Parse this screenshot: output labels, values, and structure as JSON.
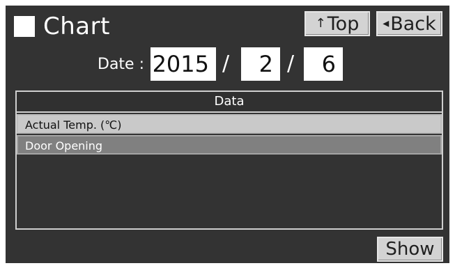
{
  "header": {
    "title": "Chart",
    "top_icon": "↑",
    "top_label": "Top",
    "back_icon": "◂",
    "back_label": "Back"
  },
  "date": {
    "label": "Date :",
    "year": "2015",
    "month": "2",
    "day": "6",
    "separator": "/"
  },
  "data_list": {
    "header": "Data",
    "items": [
      {
        "label": "Actual Temp. (℃)",
        "selected": true
      },
      {
        "label": "Door Opening",
        "selected": false
      }
    ]
  },
  "footer": {
    "show_label": "Show"
  },
  "colors": {
    "background": "#333333",
    "button": "#d3d3d3",
    "item_selected": "#c9c9c9",
    "item_unselected": "#808080"
  }
}
